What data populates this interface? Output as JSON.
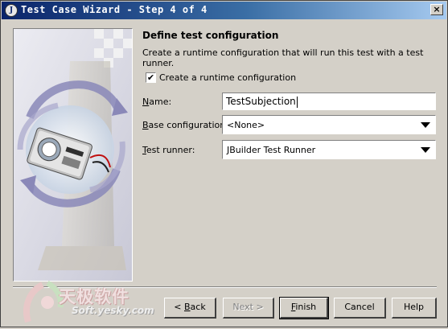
{
  "window": {
    "title": "Test Case Wizard - Step 4 of 4",
    "icon": "app-icon",
    "close_label": "×"
  },
  "page": {
    "title": "Define test configuration",
    "description": "Create a runtime configuration that will run this test with a test runner."
  },
  "options": {
    "create_runtime_checked": true,
    "create_runtime_label": "Create a runtime configuration"
  },
  "fields": {
    "name": {
      "label_mn": "N",
      "label_rest": "ame:",
      "value": "TestSubjection"
    },
    "base_configuration": {
      "label_mn": "B",
      "label_rest": "ase configuration:",
      "value": "<None>"
    },
    "test_runner": {
      "label_mn": "T",
      "label_rest": "est runner:",
      "value": "JBuilder Test Runner"
    }
  },
  "buttons": {
    "back": {
      "prefix": "< ",
      "mn": "B",
      "rest": "ack"
    },
    "next": "Next >",
    "finish": {
      "mn": "F",
      "rest": "inish"
    },
    "cancel": "Cancel",
    "help": "Help"
  },
  "watermark": {
    "cn": "天极软件",
    "url": "Soft.yesky.com"
  },
  "colors": {
    "title_start": "#0a246a",
    "title_end": "#a6caf0",
    "face": "#d4d0c8"
  }
}
